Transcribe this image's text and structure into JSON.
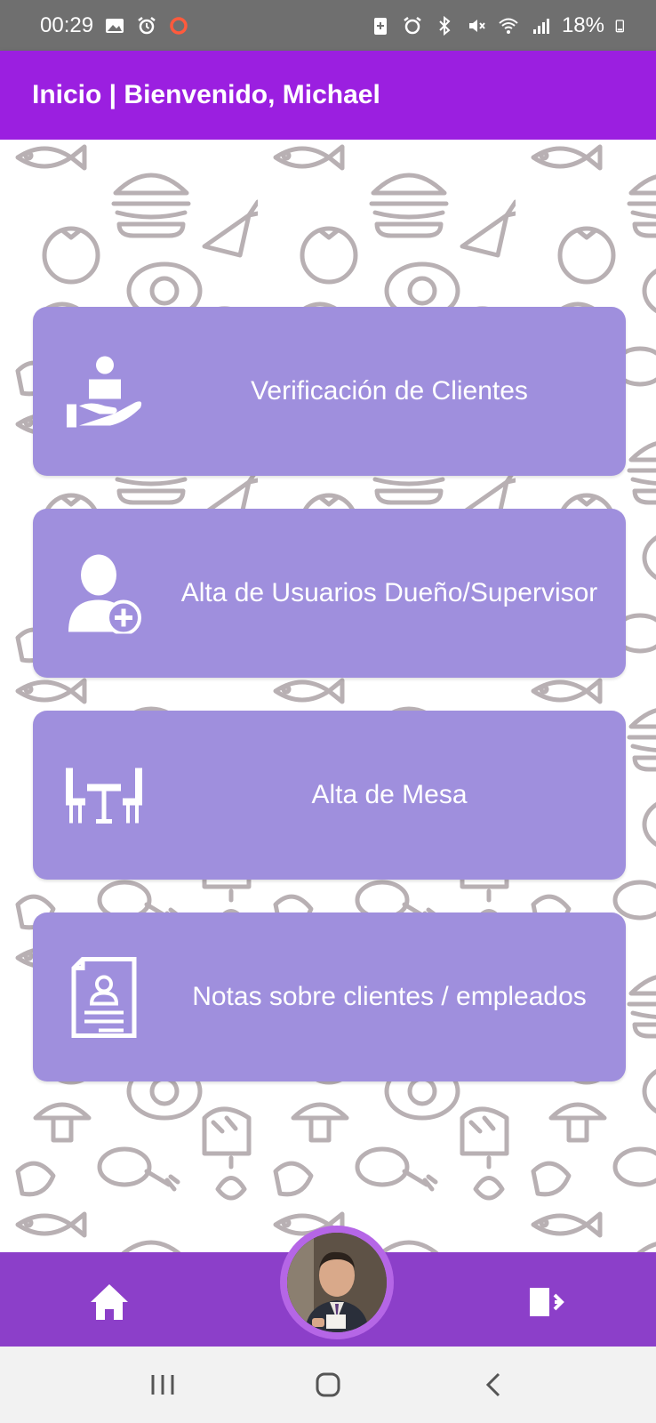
{
  "status_bar": {
    "time": "00:29",
    "battery": "18%",
    "icons_left": [
      "image-icon",
      "alarm-icon",
      "ring-icon"
    ],
    "icons_right": [
      "battery-saver-icon",
      "alarm-icon",
      "bluetooth-icon",
      "mute-icon",
      "wifi-icon",
      "signal-icon",
      "battery-icon"
    ]
  },
  "app_bar": {
    "title": "Inicio | Bienvenido, Michael"
  },
  "menu": {
    "items": [
      {
        "label": "Verificación de Clientes",
        "icon": "hand-person-icon"
      },
      {
        "label": "Alta de Usuarios Dueño/Supervisor",
        "icon": "user-add-icon"
      },
      {
        "label": "Alta de Mesa",
        "icon": "table-chairs-icon"
      },
      {
        "label": "Notas sobre clientes / empleados",
        "icon": "document-profile-icon"
      }
    ]
  },
  "bottom_nav": {
    "home_icon": "home-icon",
    "avatar": "profile-avatar",
    "logout_icon": "logout-icon"
  },
  "system_nav": {
    "recents_icon": "recents-icon",
    "home_icon": "circle-home-icon",
    "back_icon": "back-icon"
  },
  "colors": {
    "app_bar": "#9b1fe0",
    "card": "#9f8fdd",
    "bottom_nav": "#8c3fc9",
    "avatar_ring": "#b566e6",
    "status_bar": "#6f6f6f"
  }
}
